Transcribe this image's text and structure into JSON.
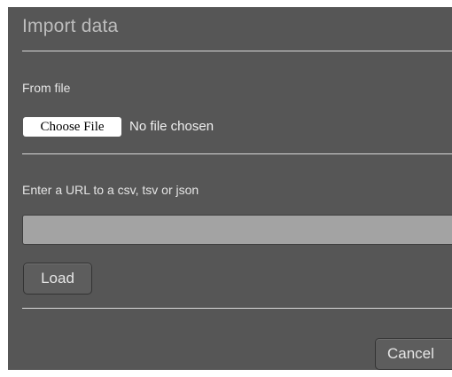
{
  "dialog": {
    "title": "Import data",
    "from_file": {
      "label": "From file",
      "choose_button": "Choose File",
      "status": "No file chosen"
    },
    "url": {
      "label": "Enter a URL to a csv, tsv or json",
      "value": "",
      "placeholder": ""
    },
    "load_button": "Load",
    "cancel_button": "Cancel"
  },
  "colors": {
    "dialog_background": "#565656",
    "input_background": "#a3a3a3",
    "text": "#e4e4e4",
    "title": "#bdbdbd"
  }
}
